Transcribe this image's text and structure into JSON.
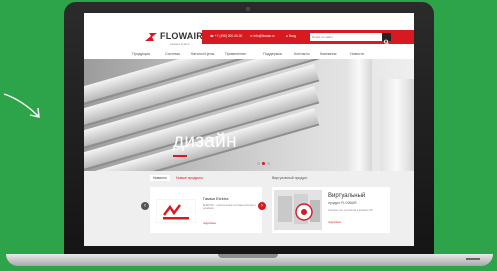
{
  "colors": {
    "background": "#2ea44a",
    "brand_red": "#d71920",
    "dark": "#222222"
  },
  "icons": [
    "arrow-icon",
    "flowair-logo-icon",
    "search-icon",
    "phone-icon",
    "mail-icon",
    "user-icon"
  ],
  "site": {
    "logo": "FLOWAIR",
    "logo_tagline": "heaters & fans",
    "topbar": {
      "phone": "+7 (495) 000-00-00",
      "email": "info@flowair.ru",
      "cabinet": "Вход",
      "search_placeholder": "Поиск по сайту"
    },
    "nav": [
      "Продукция",
      "Системы",
      "Каталог/Цены",
      "Применение",
      "Поддержка",
      "Контакты",
      "Компания",
      "Новости"
    ],
    "hero": {
      "text": "дизайн",
      "slide_count": 3,
      "active_slide": 2
    },
    "tabs": {
      "active": "Новости",
      "second": "Новые продукты"
    },
    "card_left": {
      "title": "Гамма Elektra",
      "text": "ELEKTRA – электрические тепловентиляторы с дизайном",
      "link": "подробнее"
    },
    "virtual_section": {
      "label": "Виртуальный продукт"
    },
    "card_right": {
      "title_line1": "Виртуальный",
      "title_line2": "продукт FLOWAIR",
      "text": "Смотрите все устройства в формате 3D",
      "link": "подробнее"
    }
  }
}
